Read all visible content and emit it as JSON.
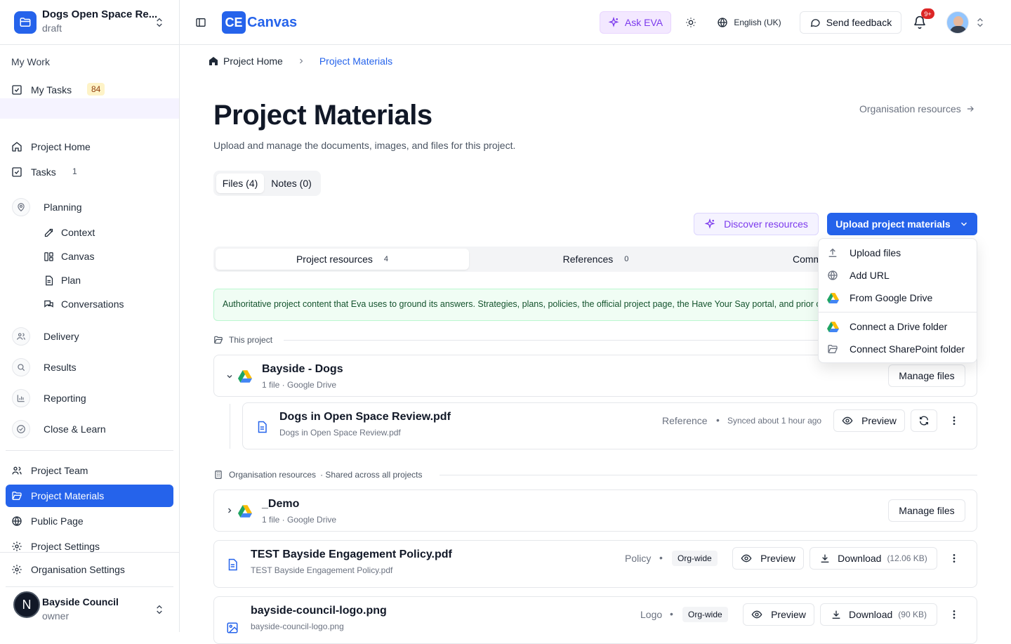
{
  "project": {
    "name": "Dogs Open Space Re...",
    "status": "draft"
  },
  "sidebar": {
    "my_work_label": "My Work",
    "my_tasks": {
      "label": "My Tasks",
      "count": "84"
    },
    "project_home": "Project Home",
    "tasks": {
      "label": "Tasks",
      "count": "1"
    },
    "planning": "Planning",
    "planning_items": [
      "Context",
      "Canvas",
      "Plan",
      "Conversations"
    ],
    "delivery": "Delivery",
    "results": "Results",
    "reporting": "Reporting",
    "close_learn": "Close & Learn",
    "project_team": "Project Team",
    "project_materials": "Project Materials",
    "public_page": "Public Page",
    "project_settings": "Project Settings",
    "org_settings": "Organisation Settings",
    "org": {
      "name": "Bayside Council",
      "role": "owner",
      "avatar_letter": "N"
    }
  },
  "topbar": {
    "logo_mark": "CE",
    "logo_text": "Canvas",
    "ask_eva": "Ask EVA",
    "language": "English (UK)",
    "feedback": "Send feedback",
    "notif_badge": "9+"
  },
  "breadcrumb": {
    "home": "Project Home",
    "current": "Project Materials"
  },
  "page": {
    "title": "Project Materials",
    "subtitle": "Upload and manage the documents, images, and files for this project.",
    "org_link": "Organisation resources",
    "tabs": [
      "Files (4)",
      "Notes (0)"
    ],
    "discover": "Discover resources",
    "upload": "Upload project materials",
    "seg": [
      {
        "label": "Project resources",
        "count": "4"
      },
      {
        "label": "References",
        "count": "0"
      },
      {
        "label": "Comm",
        "count": ""
      }
    ],
    "info": "Authoritative project content that Eva uses to ground its answers. Strategies, plans, policies, the official project page, the Have Your Say portal, and prior consultation reports."
  },
  "groups": {
    "this_project": "This project",
    "org_resources": "Organisation resources",
    "org_resources_note": "· Shared across all projects"
  },
  "folders": [
    {
      "name": "Bayside - Dogs",
      "meta": "1 file · Google Drive",
      "action": "Manage files"
    },
    {
      "name": "_Demo",
      "meta": "1 file · Google Drive",
      "action": "Manage files"
    }
  ],
  "files": [
    {
      "name": "Dogs in Open Space Review.pdf",
      "filename": "Dogs in Open Space Review.pdf",
      "type": "Reference",
      "sync": "Synced about 1 hour ago",
      "preview": "Preview"
    },
    {
      "name": "TEST Bayside Engagement Policy.pdf",
      "filename": "TEST Bayside Engagement Policy.pdf",
      "type": "Policy",
      "scope": "Org-wide",
      "preview": "Preview",
      "download": "Download",
      "size": "(12.06 KB)"
    },
    {
      "name": "bayside-council-logo.png",
      "filename": "bayside-council-logo.png",
      "type": "Logo",
      "scope": "Org-wide",
      "preview": "Preview",
      "download": "Download",
      "size": "(90 KB)"
    }
  ],
  "dropdown": [
    "Upload files",
    "Add URL",
    "From Google Drive",
    "Connect a Drive folder",
    "Connect SharePoint folder"
  ],
  "colors": {
    "primary": "#2563eb",
    "eva_purple": "#7c3aed",
    "info_bg": "#f0fdf4",
    "badge_amber": "#fef3c7",
    "notif_red": "#dc2626"
  }
}
